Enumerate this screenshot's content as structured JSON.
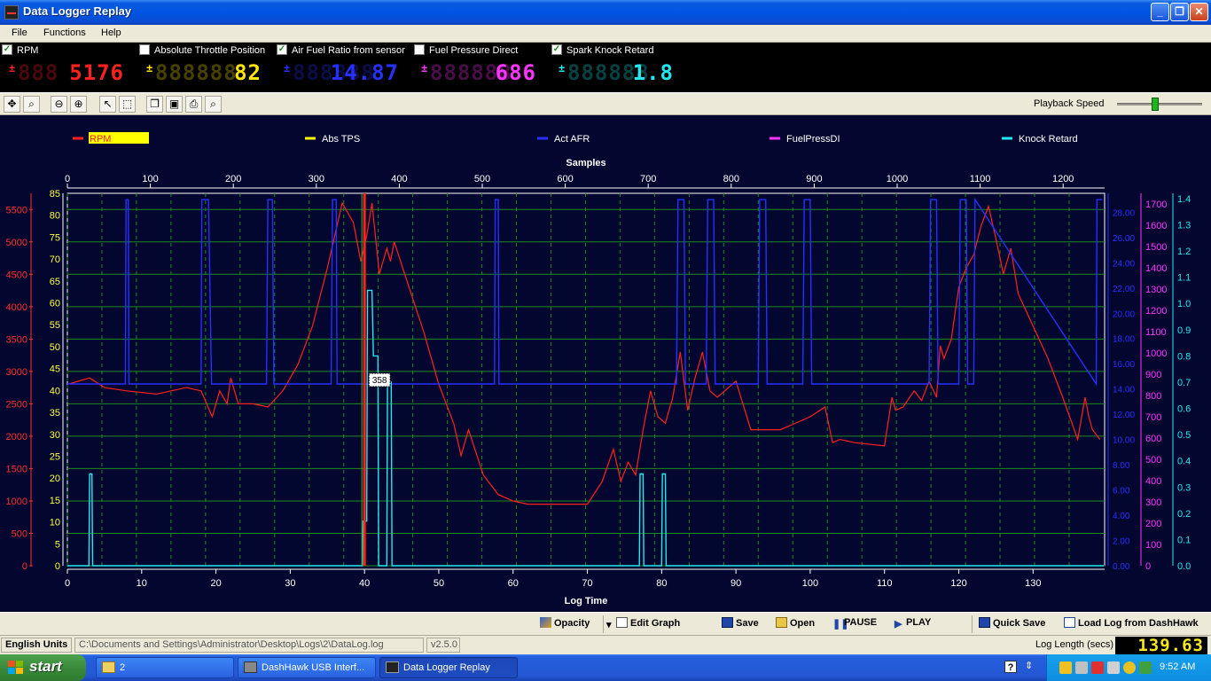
{
  "window": {
    "title": "Data Logger Replay",
    "controls": {
      "minimize": "_",
      "maximize": "❐",
      "close": "✕"
    }
  },
  "menu": [
    "File",
    "Functions",
    "Help"
  ],
  "gauges": [
    {
      "label": "Absolute Throttle Position",
      "checked": false,
      "ghost": "888888",
      "value": "82",
      "color": "#ffe600"
    },
    {
      "label": "Air Fuel Ratio from sensor",
      "checked": true,
      "ghost": "888888",
      "value": "14.87",
      "color": "#2630ff"
    },
    {
      "label": "Fuel Pressure Direct",
      "checked": false,
      "ghost": "888888",
      "value": "686",
      "color": "#ff33ff"
    },
    {
      "label": "Spark Knock Retard",
      "checked": true,
      "ghost": "888888",
      "value": "1.8",
      "color": "#22e8f0"
    }
  ],
  "rpm_gauge": {
    "label": "RPM",
    "checked": true,
    "ghost": "888",
    "value": "5176",
    "color": "#ff2020"
  },
  "toolbar": {
    "icons": [
      "pan-icon",
      "zoom-icon",
      "zoom-out-icon",
      "zoom-in-icon",
      "pointer-icon",
      "select-icon",
      "copy-icon",
      "save-icon",
      "print-icon",
      "preview-icon"
    ],
    "playback_label": "Playback Speed",
    "playback_speed": 0.45
  },
  "chart_data": {
    "type": "line",
    "legend": [
      {
        "name": "RPM",
        "color": "#ff2020",
        "highlight": "#ffff00"
      },
      {
        "name": "Abs TPS",
        "color": "#ffff00"
      },
      {
        "name": "Act AFR",
        "color": "#2630ff"
      },
      {
        "name": "FuelPressDI",
        "color": "#ff33ff"
      },
      {
        "name": "Knock Retard",
        "color": "#22e8f0"
      }
    ],
    "top_axis_label": "Samples",
    "top_ticks": [
      0,
      100,
      200,
      300,
      400,
      500,
      600,
      700,
      800,
      900,
      1000,
      1100,
      1200
    ],
    "bottom_axis_label": "Log Time",
    "bottom_ticks": [
      0,
      10,
      20,
      30,
      40,
      50,
      60,
      70,
      80,
      90,
      100,
      110,
      120,
      130
    ],
    "xlim": [
      0,
      139.63
    ],
    "left_axis_rpm": {
      "ticks": [
        0,
        500,
        1000,
        1500,
        2000,
        2500,
        3000,
        3500,
        4000,
        4500,
        5000,
        5500
      ],
      "ylim": [
        0,
        5750
      ],
      "color": "#ff3030"
    },
    "left_axis_tps": {
      "ticks": [
        0,
        5,
        10,
        15,
        20,
        25,
        30,
        35,
        40,
        45,
        50,
        55,
        60,
        65,
        70,
        75,
        80,
        85
      ],
      "ylim": [
        0,
        85
      ],
      "color": "#ffff40"
    },
    "right_axis_afr": {
      "ticks": [
        "0.00",
        "2.00",
        "4.00",
        "6.00",
        "8.00",
        "10.00",
        "12.00",
        "14.00",
        "16.00",
        "18.00",
        "20.00",
        "22.00",
        "24.00",
        "26.00",
        "28.00"
      ],
      "ylim": [
        0,
        29.5
      ],
      "color": "#2630ff"
    },
    "right_axis_fuel": {
      "ticks": [
        0,
        100,
        200,
        300,
        400,
        500,
        600,
        700,
        800,
        900,
        1000,
        1100,
        1200,
        1300,
        1400,
        1500,
        1600,
        1700
      ],
      "ylim": [
        0,
        1750
      ],
      "color": "#ff33ff"
    },
    "right_axis_knock": {
      "ticks": [
        "0.0",
        "0.1",
        "0.2",
        "0.3",
        "0.4",
        "0.5",
        "0.6",
        "0.7",
        "0.8",
        "0.9",
        "1.0",
        "1.1",
        "1.2",
        "1.3",
        "1.4"
      ],
      "ylim": [
        0,
        1.42
      ],
      "color": "#22e8f0"
    },
    "cursor": {
      "time": 40,
      "label": "358"
    },
    "series": [
      {
        "name": "RPM",
        "color": "#ff2020",
        "axis": "rpm",
        "x": [
          0,
          3,
          5,
          8,
          12,
          16,
          18,
          19.5,
          20.5,
          21.5,
          22,
          22.5,
          23,
          25,
          27,
          29,
          31,
          33,
          35,
          37,
          38.5,
          39.5,
          40.3,
          41,
          42,
          43,
          43.5,
          44,
          46,
          48,
          50,
          52,
          53,
          54,
          56,
          58,
          60,
          62,
          66,
          70,
          72,
          73.5,
          74.5,
          75.5,
          76.5,
          77.5,
          78.5,
          79.5,
          80.5,
          81.5,
          82.5,
          83.5,
          84.5,
          85.5,
          86.5,
          87.5,
          88.5,
          89.5,
          90,
          92,
          96,
          100,
          102,
          103,
          104,
          106,
          110,
          111,
          111.5,
          112.5,
          114,
          115,
          116,
          117,
          117.5,
          118,
          119,
          120,
          121,
          122,
          123,
          124,
          124.7,
          125,
          126,
          127,
          128,
          130,
          132,
          134,
          136,
          137,
          137.5,
          138,
          139
        ],
        "y": [
          2800,
          2900,
          2750,
          2700,
          2650,
          2750,
          2700,
          2300,
          2700,
          2500,
          2900,
          2700,
          2500,
          2500,
          2450,
          2700,
          3100,
          3700,
          4600,
          5600,
          5300,
          4700,
          5100,
          5600,
          4500,
          4900,
          4700,
          5000,
          4300,
          3600,
          2800,
          2200,
          1700,
          2100,
          1400,
          1100,
          1000,
          950,
          950,
          950,
          1300,
          1800,
          1300,
          1600,
          1400,
          2100,
          2700,
          2300,
          2200,
          2600,
          3300,
          2400,
          2900,
          3300,
          2700,
          2600,
          2700,
          2800,
          2850,
          2100,
          2100,
          2300,
          2450,
          1900,
          1950,
          1900,
          1850,
          2600,
          2400,
          2450,
          2700,
          2550,
          2850,
          2600,
          3400,
          3200,
          3500,
          4300,
          4600,
          4800,
          5250,
          5550,
          5200,
          5050,
          4500,
          4900,
          4200,
          3700,
          3200,
          2600,
          1950,
          2600,
          2300,
          2100,
          1950
        ]
      },
      {
        "name": "Act AFR",
        "color": "#2630ff",
        "axis": "afr",
        "x": [
          0,
          7.8,
          7.9,
          8.2,
          8.3,
          18,
          18.1,
          18.3,
          19,
          19.4,
          20,
          20.1,
          26.8,
          27,
          27.6,
          27.8,
          35.5,
          35.7,
          36.2,
          36.3,
          57.5,
          57.6,
          58,
          58.1,
          82,
          82.2,
          83,
          83.2,
          86,
          86.2,
          87,
          87.2,
          93,
          93.2,
          94,
          94.2,
          99,
          99.2,
          100,
          100.2,
          116,
          116.2,
          117,
          117.2,
          120,
          120.2,
          121,
          121.2,
          122,
          122.2,
          138.5,
          138.6,
          139.3
        ],
        "y": [
          14.4,
          14.4,
          29,
          29,
          14.4,
          14.4,
          29,
          29,
          29,
          14.4,
          14.4,
          14.4,
          14.4,
          29,
          29,
          14.4,
          14.4,
          29,
          29,
          14.4,
          14.4,
          29,
          29,
          14.4,
          14.4,
          29,
          29,
          14.4,
          14.4,
          29,
          29,
          14.4,
          14.4,
          29,
          29,
          14.4,
          14.4,
          29,
          29,
          14.4,
          14.4,
          29,
          29,
          14.4,
          14.4,
          29,
          29,
          14.4,
          14.4,
          29,
          14.4,
          29,
          29
        ]
      },
      {
        "name": "Knock Retard",
        "color": "#22e8f0",
        "axis": "knock",
        "x": [
          0,
          2.9,
          3.0,
          3.3,
          3.4,
          39.7,
          39.8,
          40.3,
          40.4,
          40.5,
          41,
          41.2,
          41.8,
          41.9,
          43,
          43.1,
          43.6,
          43.7,
          77,
          77.1,
          77.5,
          77.6,
          80,
          80.1,
          80.5,
          80.6,
          139.5
        ],
        "y": [
          0,
          0,
          0.35,
          0.35,
          0,
          0,
          0.17,
          0.17,
          1.05,
          1.05,
          1.05,
          0.8,
          0.8,
          0,
          0,
          0.7,
          0.7,
          0,
          0,
          0.35,
          0.35,
          0,
          0,
          0.35,
          0.35,
          0,
          0
        ]
      }
    ]
  },
  "controls": {
    "opacity": "Opacity",
    "edit_graph": "Edit Graph",
    "save": "Save",
    "open": "Open",
    "pause": "PAUSE",
    "play": "PLAY",
    "quick_save": "Quick Save",
    "load_log": "Load Log from DashHawk"
  },
  "status": {
    "units": "English Units",
    "path": "C:\\Documents and Settings\\Administrator\\Desktop\\Logs\\2\\DataLog.log",
    "version": "v2.5.0",
    "log_length_label": "Log Length (secs)",
    "log_length_value": "139.63"
  },
  "taskbar": {
    "start": "start",
    "tasks": [
      "2",
      "DashHawk USB Interf...",
      "Data Logger Replay"
    ],
    "clock": "9:52 AM"
  }
}
